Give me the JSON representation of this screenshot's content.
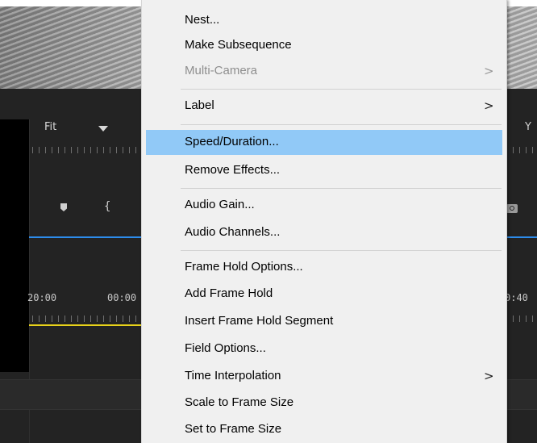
{
  "background": {
    "fit_label": "Fit",
    "right_partial": "Y",
    "times": [
      "20:00",
      "00:00",
      "0:40"
    ]
  },
  "menu": {
    "items": [
      {
        "label": "Nest...",
        "disabled": false,
        "submenu": false,
        "highlighted": false
      },
      {
        "label": "Make Subsequence",
        "disabled": false,
        "submenu": false,
        "highlighted": false
      },
      {
        "label": "Multi-Camera",
        "disabled": true,
        "submenu": true,
        "highlighted": false
      },
      {
        "label": "Label",
        "disabled": false,
        "submenu": true,
        "highlighted": false
      },
      {
        "label": "Speed/Duration...",
        "disabled": false,
        "submenu": false,
        "highlighted": true
      },
      {
        "label": "Remove Effects...",
        "disabled": false,
        "submenu": false,
        "highlighted": false
      },
      {
        "label": "Audio Gain...",
        "disabled": false,
        "submenu": false,
        "highlighted": false
      },
      {
        "label": "Audio Channels...",
        "disabled": false,
        "submenu": false,
        "highlighted": false
      },
      {
        "label": "Frame Hold Options...",
        "disabled": false,
        "submenu": false,
        "highlighted": false
      },
      {
        "label": "Add Frame Hold",
        "disabled": false,
        "submenu": false,
        "highlighted": false
      },
      {
        "label": "Insert Frame Hold Segment",
        "disabled": false,
        "submenu": false,
        "highlighted": false
      },
      {
        "label": "Field Options...",
        "disabled": false,
        "submenu": false,
        "highlighted": false
      },
      {
        "label": "Time Interpolation",
        "disabled": false,
        "submenu": true,
        "highlighted": false
      },
      {
        "label": "Scale to Frame Size",
        "disabled": false,
        "submenu": false,
        "highlighted": false
      },
      {
        "label": "Set to Frame Size",
        "disabled": false,
        "submenu": false,
        "highlighted": false
      }
    ],
    "submenu_arrow": ">",
    "highlight_color": "#91c9f7"
  },
  "colors": {
    "playhead_blue": "#2d8ceb",
    "work_area_yellow": "#e8d21a"
  },
  "icons": [
    "marker-icon",
    "brace-icon",
    "camera-icon",
    "dropdown-arrow-icon",
    "submenu-arrow-icon"
  ]
}
